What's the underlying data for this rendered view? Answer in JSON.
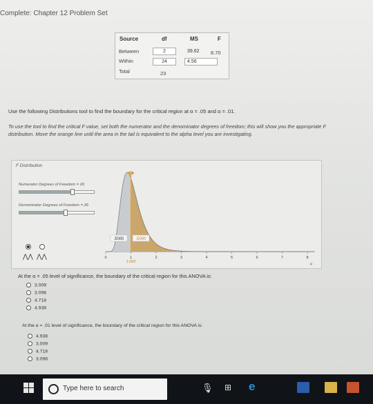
{
  "page": {
    "title": "Complete: Chapter 12 Problem Set"
  },
  "anova": {
    "headers": {
      "source": "Source",
      "df": "df",
      "ms": "MS",
      "f": "F"
    },
    "rows": [
      {
        "source": "Between",
        "df": "2",
        "ms": "39.62",
        "f": "8.70"
      },
      {
        "source": "Within",
        "df": "24",
        "ms": "4.56",
        "f": ""
      },
      {
        "source": "Total",
        "df": "23",
        "ms": "",
        "f": ""
      }
    ]
  },
  "instructions": {
    "line1": "Use the following Distributions tool to find the boundary for the critical region at α = .05 and α = .01.",
    "line2": "To use the tool to find the critical F value, set both the numerator and the denominator degrees of freedom; this will show you the appropriate F distribution. Move the orange line until the area in the tail is equivalent to the alpha level you are investigating."
  },
  "distribution": {
    "title": "F Distribution",
    "numerator_label": "Numerator Degrees of Freedom = 26",
    "denominator_label": "Denominator Degrees of Freedom = 26",
    "numerator_df": 26,
    "denominator_df": 26,
    "left_area_label": ".5000",
    "right_area_label": ".5000",
    "cursor_value": "1.000",
    "x_ticks": [
      "0",
      "1",
      "2",
      "3",
      "4",
      "5",
      "6",
      "7",
      "8"
    ],
    "x_axis_symbol": "F",
    "colors": {
      "curve_fill": "#c8cbd0",
      "tail_fill": "#c9a66b",
      "cursor": "#e8a33a"
    }
  },
  "question1": {
    "prompt": "At the α = .05 level of significance, the boundary of the critical region for this ANOVA is:",
    "options": [
      "3.009",
      "3.098",
      "4.718",
      "4.938"
    ]
  },
  "question2": {
    "prompt": "At the α = .01 level of significance, the boundary of the critical region for this ANOVA is:",
    "options": [
      "4.938",
      "3.009",
      "4.718",
      "3.098"
    ]
  },
  "taskbar": {
    "search_placeholder": "Type here to search",
    "icons": [
      "windows-start-icon",
      "cortana-icon",
      "mic-icon",
      "task-view-icon",
      "edge-icon",
      "word-icon",
      "file-explorer-icon",
      "powerpoint-icon"
    ]
  }
}
